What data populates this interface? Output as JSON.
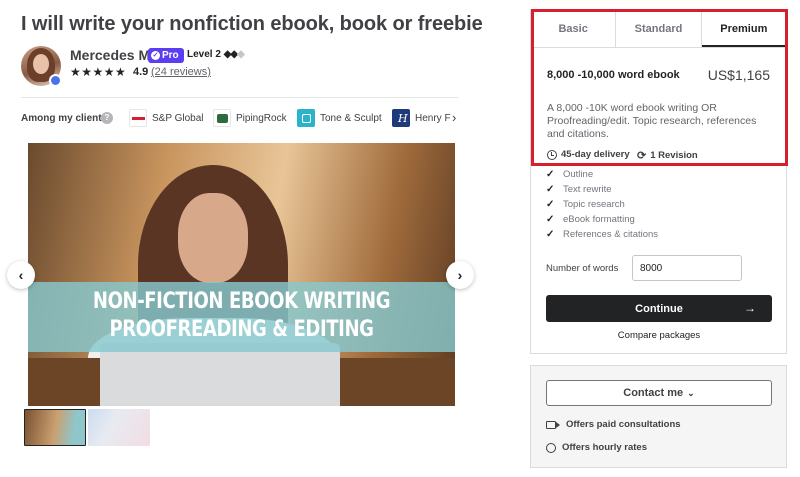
{
  "gig": {
    "title": "I will write your nonfiction ebook, book or freebie"
  },
  "seller": {
    "name": "Mercedes M.",
    "pro_label": "Pro",
    "level": "Level 2",
    "level_diamonds": "◆◆",
    "level_empty": "◆",
    "stars": "★★★★★",
    "rating": "4.9",
    "reviews": "(24 reviews)"
  },
  "clients": {
    "label": "Among my clients",
    "items": [
      {
        "name": "S&P Global",
        "logo_color": "#d6202e"
      },
      {
        "name": "PipingRock",
        "logo_color": "#2f6a3f"
      },
      {
        "name": "Tone & Sculpt",
        "logo_color": "#2ab3c9"
      },
      {
        "name": "Henry F",
        "logo_color": "#1e3a7a"
      }
    ]
  },
  "gallery": {
    "banner_line1": "NON-FICTION EBOOK WRITING",
    "banner_line2": "PROOFREADING & EDITING"
  },
  "packages": {
    "tabs": [
      "Basic",
      "Standard",
      "Premium"
    ],
    "active_tab": "Premium",
    "title": "8,000 -10,000 word ebook",
    "price": "US$1,165",
    "description": "A 8,000 -10K word ebook writing OR Proofreading/edit. Topic research, references and citations.",
    "delivery": "45-day delivery",
    "revisions": "1 Revision",
    "features": [
      "Outline",
      "Text rewrite",
      "Topic research",
      "eBook formatting",
      "References & citations"
    ],
    "words_label": "Number of words",
    "words_value": "8000",
    "continue_label": "Continue",
    "compare_label": "Compare packages"
  },
  "contact": {
    "button_label": "Contact me",
    "line1": "Offers paid consultations",
    "line2": "Offers hourly rates"
  },
  "colors": {
    "highlight": "#d6202e",
    "pro_badge": "#5c3ef2",
    "primary_button": "#222325"
  }
}
